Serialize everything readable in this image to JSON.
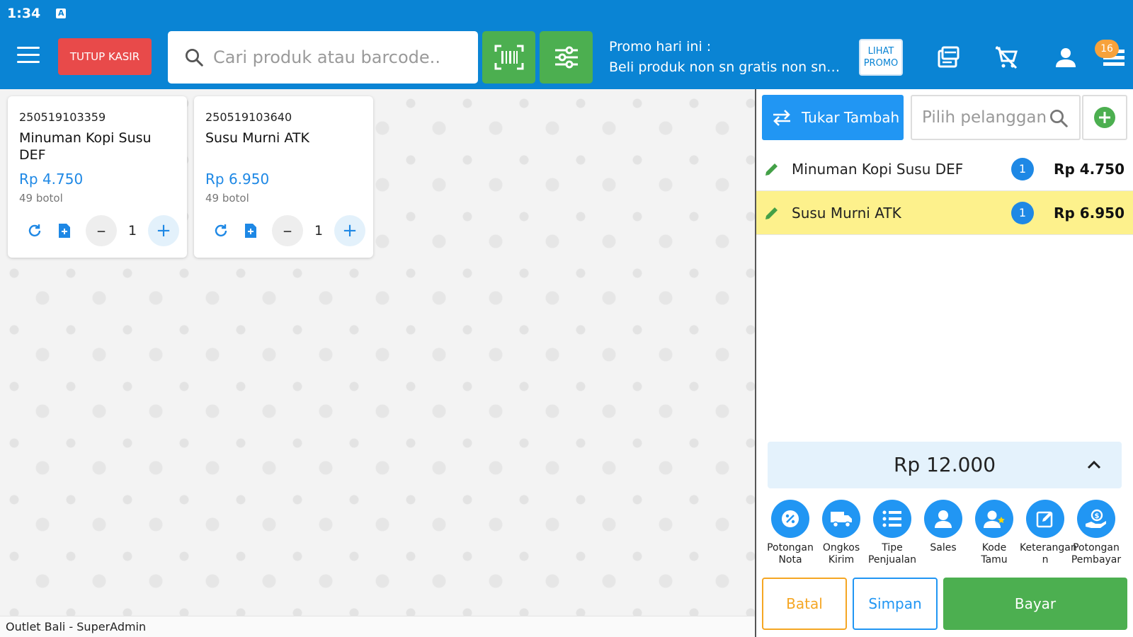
{
  "status": {
    "time": "1:34",
    "badge": "A"
  },
  "header": {
    "close_cashier_label": "TUTUP KASIR",
    "search_placeholder": "Cari produk atau barcode..",
    "promo_title": "Promo hari ini :",
    "promo_text": "Beli produk non sn gratis non sn seri",
    "promo_btn_line1": "LIHAT",
    "promo_btn_line2": "PROMO",
    "notif_count": "16"
  },
  "products": [
    {
      "code": "250519103359",
      "name": "Minuman Kopi Susu DEF",
      "price": "Rp 4.750",
      "stock": "49 botol",
      "qty": "1"
    },
    {
      "code": "250519103640",
      "name": "Susu Murni ATK",
      "price": "Rp 6.950",
      "stock": "49 botol",
      "qty": "1"
    }
  ],
  "footer": {
    "outlet": "Outlet Bali - SuperAdmin"
  },
  "cart": {
    "exchange_label": "Tukar Tambah",
    "customer_placeholder": "Pilih pelanggan",
    "items": [
      {
        "name": "Minuman Kopi Susu DEF",
        "qty": "1",
        "price": "Rp 4.750"
      },
      {
        "name": "Susu Murni ATK",
        "qty": "1",
        "price": "Rp 6.950"
      }
    ],
    "total": "Rp 12.000",
    "actions": [
      {
        "line1": "Potongan",
        "line2": "Nota",
        "icon": "discount-icon"
      },
      {
        "line1": "Ongkos",
        "line2": "Kirim",
        "icon": "truck-icon"
      },
      {
        "line1": "Tipe",
        "line2": "Penjualan",
        "icon": "list-icon"
      },
      {
        "line1": "Sales",
        "line2": "",
        "icon": "person-icon"
      },
      {
        "line1": "Kode",
        "line2": "Tamu",
        "icon": "guest-icon"
      },
      {
        "line1": "Keterangan",
        "line2": "n",
        "icon": "note-icon"
      },
      {
        "line1": "Potongan",
        "line2": "Pembayar",
        "icon": "payment-icon"
      }
    ],
    "cancel_label": "Batal",
    "save_label": "Simpan",
    "pay_label": "Bayar"
  },
  "colors": {
    "header_blue": "#0a84d4",
    "green": "#4caf50",
    "red": "#e84a4a",
    "accent_blue": "#2196f3",
    "selected_row": "#fdf18c",
    "orange": "#f5a623"
  }
}
